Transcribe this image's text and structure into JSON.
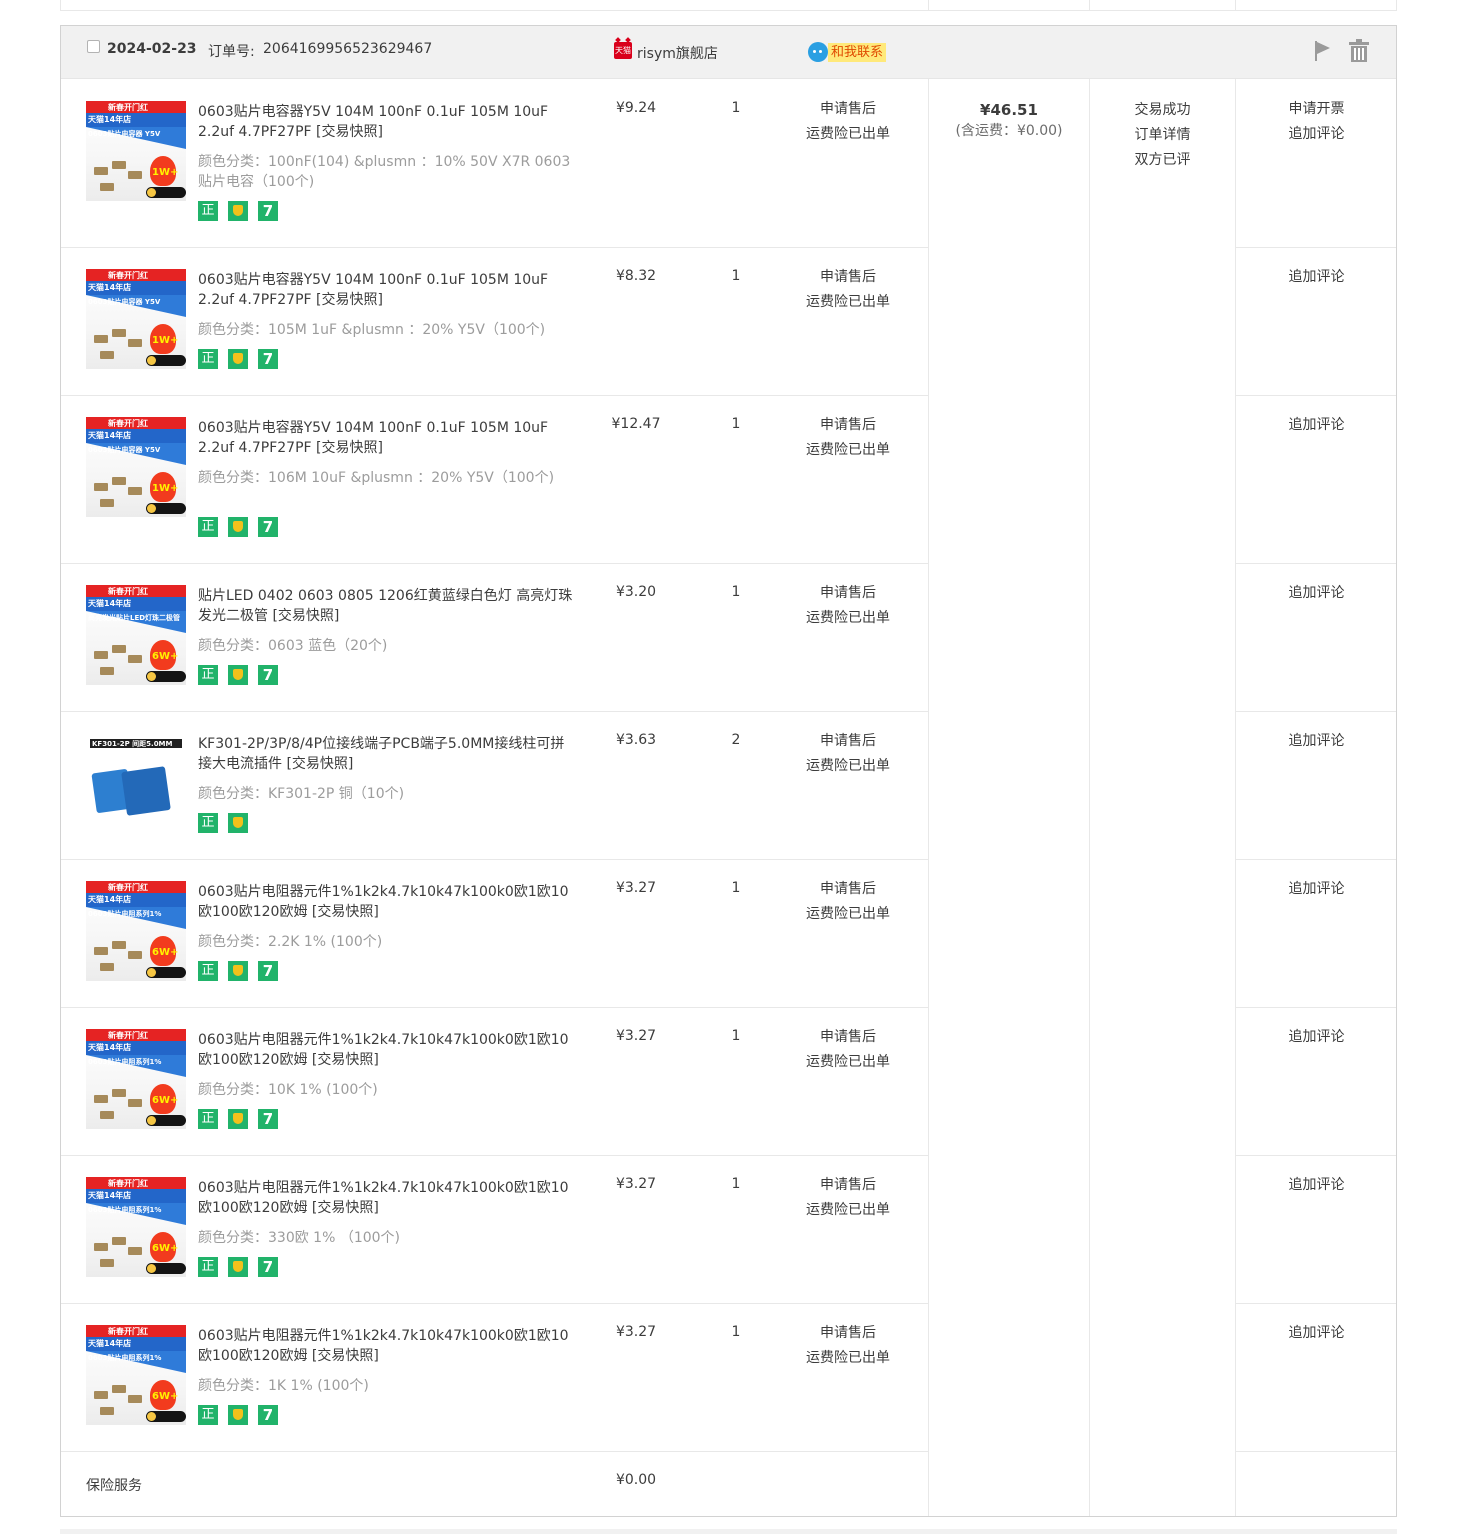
{
  "order": {
    "date": "2024-02-23",
    "number_label": "订单号:",
    "number": "2064169956523629467",
    "shop_icon": "天猫",
    "shop_name": "risym旗舰店",
    "contact_label": "和我联系",
    "total_price": "¥46.51",
    "total_shipping": "(含运费：¥0.00)",
    "status_lines": [
      "交易成功",
      "订单详情",
      "双方已评"
    ],
    "icons": {
      "flag": "flag-icon",
      "trash": "trash-icon",
      "wangwang": "chat-icon"
    }
  },
  "items": [
    {
      "title": "0603贴片电容器Y5V 104M 100nF 0.1uF 105M 10uF 2.2uf 4.7PF27PF [交易快照]",
      "attr": "颜色分类：100nF(104) &plusmn ：10% 50V X7R 0603贴片电容（100个)",
      "price": "¥9.24",
      "qty": "1",
      "svc": [
        "申请售后",
        "运费险已出单"
      ],
      "ops": [
        "申请开票",
        "追加评论"
      ],
      "tags": [
        "正",
        "shield",
        "7"
      ]
    },
    {
      "title": "0603贴片电容器Y5V 104M 100nF 0.1uF 105M 10uF 2.2uf 4.7PF27PF [交易快照]",
      "attr": "颜色分类：105M 1uF &plusmn ：20% Y5V（100个)",
      "price": "¥8.32",
      "qty": "1",
      "svc": [
        "申请售后",
        "运费险已出单"
      ],
      "ops": [
        "追加评论"
      ],
      "tags": [
        "正",
        "shield",
        "7"
      ]
    },
    {
      "title": "0603贴片电容器Y5V 104M 100nF 0.1uF 105M 10uF 2.2uf 4.7PF27PF [交易快照]",
      "attr": "颜色分类：106M 10uF &plusmn ：20% Y5V（100个)",
      "price": "¥12.47",
      "qty": "1",
      "svc": [
        "申请售后",
        "运费险已出单"
      ],
      "ops": [
        "追加评论"
      ],
      "tags": [
        "正",
        "shield",
        "7"
      ]
    },
    {
      "title": "贴片LED 0402 0603 0805 1206红黄蓝绿白色灯 高亮灯珠发光二极管 [交易快照]",
      "attr": "颜色分类：0603 蓝色（20个)",
      "price": "¥3.20",
      "qty": "1",
      "svc": [
        "申请售后",
        "运费险已出单"
      ],
      "ops": [
        "追加评论"
      ],
      "tags": [
        "正",
        "shield",
        "7"
      ]
    },
    {
      "title": "KF301-2P/3P/8/4P位接线端子PCB端子5.0MM接线柱可拼接大电流插件 [交易快照]",
      "attr": "颜色分类：KF301-2P 铜（10个)",
      "price": "¥3.63",
      "qty": "2",
      "svc": [
        "申请售后",
        "运费险已出单"
      ],
      "ops": [
        "追加评论"
      ],
      "tags": [
        "正",
        "shield"
      ]
    },
    {
      "title": "0603贴片电阻器元件1%1k2k4.7k10k47k100k0欧1欧10欧100欧120欧姆 [交易快照]",
      "attr": "颜色分类：2.2K 1% (100个)",
      "price": "¥3.27",
      "qty": "1",
      "svc": [
        "申请售后",
        "运费险已出单"
      ],
      "ops": [
        "追加评论"
      ],
      "tags": [
        "正",
        "shield",
        "7"
      ]
    },
    {
      "title": "0603贴片电阻器元件1%1k2k4.7k10k47k100k0欧1欧10欧100欧120欧姆 [交易快照]",
      "attr": "颜色分类：10K 1% (100个)",
      "price": "¥3.27",
      "qty": "1",
      "svc": [
        "申请售后",
        "运费险已出单"
      ],
      "ops": [
        "追加评论"
      ],
      "tags": [
        "正",
        "shield",
        "7"
      ]
    },
    {
      "title": "0603贴片电阻器元件1%1k2k4.7k10k47k100k0欧1欧10欧100欧120欧姆 [交易快照]",
      "attr": "颜色分类：330欧 1% （100个)",
      "price": "¥3.27",
      "qty": "1",
      "svc": [
        "申请售后",
        "运费险已出单"
      ],
      "ops": [
        "追加评论"
      ],
      "tags": [
        "正",
        "shield",
        "7"
      ]
    },
    {
      "title": "0603贴片电阻器元件1%1k2k4.7k10k47k100k0欧1欧10欧100欧120欧姆 [交易快照]",
      "attr": "颜色分类：1K 1% (100个)",
      "price": "¥3.27",
      "qty": "1",
      "svc": [
        "申请售后",
        "运费险已出单"
      ],
      "ops": [
        "追加评论"
      ],
      "tags": [
        "正",
        "shield",
        "7"
      ]
    }
  ],
  "insurance": {
    "label": "保险服务",
    "price": "¥0.00"
  },
  "thumb_text": {
    "cap_banner": "新春开门红",
    "cap_sub": "天猫14年店",
    "cap_line": "0603贴片电容器 Y5V",
    "res_line": "0603贴片电阻系列1%",
    "led_line": "高亮发光贴片LED灯珠二极管",
    "term_label": "KF301-2P 间距5.0MM",
    "promo_1w": "1W+",
    "promo_6w": "6W+"
  },
  "colors": {
    "green_tag": "#21b36a",
    "price_text": "#3c3c3c",
    "muted_text": "#9c9c9c",
    "header_bg": "#f1f1f1",
    "contact_bg": "#ffe97a"
  }
}
